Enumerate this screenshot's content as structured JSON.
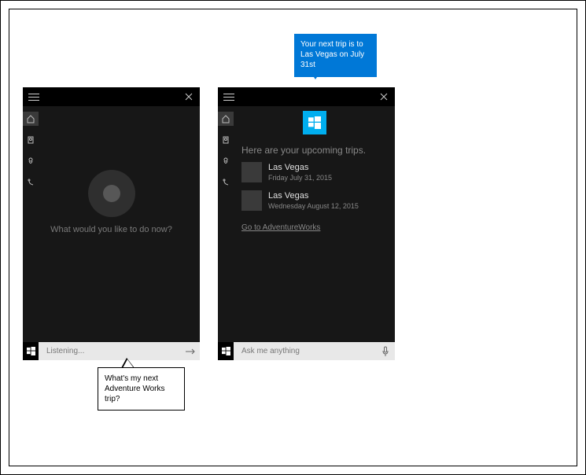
{
  "callout_blue": "Your next trip is to Las Vegas on July 31st",
  "callout_white": "What's my next Adventure Works trip?",
  "left_panel": {
    "prompt": "What would you like to do now?",
    "input_placeholder": "Listening..."
  },
  "right_panel": {
    "heading": "Here are your upcoming trips.",
    "trips": [
      {
        "destination": "Las Vegas",
        "date": "Friday July 31, 2015"
      },
      {
        "destination": "Las Vegas",
        "date": "Wednesday August 12, 2015"
      }
    ],
    "app_link": "Go to AdventureWorks",
    "input_placeholder": "Ask me anything"
  }
}
